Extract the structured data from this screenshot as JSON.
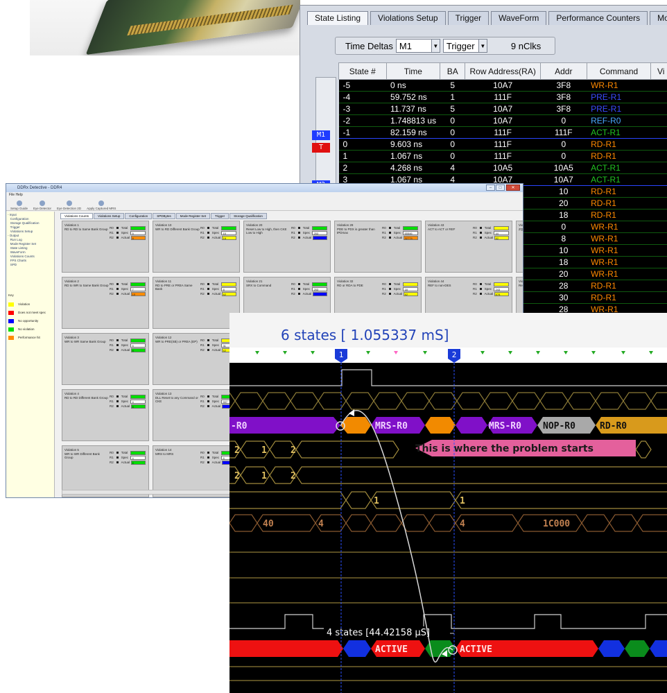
{
  "state_listing": {
    "tabs": [
      "State Listing",
      "Violations Setup",
      "Trigger",
      "WaveForm",
      "Performance Counters",
      "Mo"
    ],
    "time_deltas_label": "Time Deltas",
    "from_marker": "M1",
    "to_marker": "Trigger",
    "nclks": "9 nClks",
    "columns": [
      "State #",
      "Time",
      "BA",
      "Row Address(RA)",
      "Addr",
      "Command",
      "Vi"
    ],
    "markers": [
      {
        "label": "M1",
        "color": "#1f3cff"
      },
      {
        "label": "T",
        "color": "#e01010"
      },
      {
        "label": "M2",
        "color": "#1f3cff"
      }
    ],
    "rows": [
      {
        "state": "-5",
        "time": "0 ns",
        "ba": "5",
        "ra": "10A7",
        "addr": "3F8",
        "cmd": "WR-R1",
        "color": "#ff8a00"
      },
      {
        "state": "-4",
        "time": "59.752 ns",
        "ba": "1",
        "ra": "111F",
        "addr": "3F8",
        "cmd": "PRE-R1",
        "color": "#3a4dff"
      },
      {
        "state": "-3",
        "time": "11.737 ns",
        "ba": "5",
        "ra": "10A7",
        "addr": "3F8",
        "cmd": "PRE-R1",
        "color": "#3a4dff"
      },
      {
        "state": "-2",
        "time": "1.748813 us",
        "ba": "0",
        "ra": "10A7",
        "addr": "0",
        "cmd": "REF-R0",
        "color": "#4aa8ff"
      },
      {
        "state": "-1",
        "time": "82.159 ns",
        "ba": "0",
        "ra": "111F",
        "addr": "111F",
        "cmd": "ACT-R1",
        "color": "#21c421"
      },
      {
        "state": "0",
        "time": "9.603 ns",
        "ba": "0",
        "ra": "111F",
        "addr": "0",
        "cmd": "RD-R1",
        "color": "#ff8a00"
      },
      {
        "state": "1",
        "time": "1.067 ns",
        "ba": "0",
        "ra": "111F",
        "addr": "0",
        "cmd": "RD-R1",
        "color": "#ff8a00"
      },
      {
        "state": "2",
        "time": "4.268 ns",
        "ba": "4",
        "ra": "10A5",
        "addr": "10A5",
        "cmd": "ACT-R1",
        "color": "#21c421"
      },
      {
        "state": "3",
        "time": "1.067 ns",
        "ba": "4",
        "ra": "10A7",
        "addr": "10A7",
        "cmd": "ACT-R1",
        "color": "#21c421"
      },
      {
        "state": "",
        "time": "",
        "ba": "",
        "ra": "",
        "addr": "10",
        "cmd": "RD-R1",
        "color": "#ff8a00"
      },
      {
        "state": "",
        "time": "",
        "ba": "",
        "ra": "",
        "addr": "20",
        "cmd": "RD-R1",
        "color": "#ff8a00"
      },
      {
        "state": "",
        "time": "",
        "ba": "",
        "ra": "",
        "addr": "18",
        "cmd": "RD-R1",
        "color": "#ff8a00"
      },
      {
        "state": "",
        "time": "",
        "ba": "",
        "ra": "",
        "addr": "0",
        "cmd": "WR-R1",
        "color": "#ff8a00"
      },
      {
        "state": "",
        "time": "",
        "ba": "",
        "ra": "",
        "addr": "8",
        "cmd": "WR-R1",
        "color": "#ff8a00"
      },
      {
        "state": "",
        "time": "",
        "ba": "",
        "ra": "",
        "addr": "10",
        "cmd": "WR-R1",
        "color": "#ff8a00"
      },
      {
        "state": "",
        "time": "",
        "ba": "",
        "ra": "",
        "addr": "18",
        "cmd": "WR-R1",
        "color": "#ff8a00"
      },
      {
        "state": "",
        "time": "",
        "ba": "",
        "ra": "",
        "addr": "20",
        "cmd": "WR-R1",
        "color": "#ff8a00"
      },
      {
        "state": "",
        "time": "",
        "ba": "",
        "ra": "",
        "addr": "28",
        "cmd": "RD-R1",
        "color": "#ff8a00"
      },
      {
        "state": "",
        "time": "",
        "ba": "",
        "ra": "",
        "addr": "30",
        "cmd": "RD-R1",
        "color": "#ff8a00"
      },
      {
        "state": "",
        "time": "",
        "ba": "",
        "ra": "",
        "addr": "28",
        "cmd": "WR-R1",
        "color": "#ff8a00"
      }
    ]
  },
  "detective": {
    "title": "DDRx Detective - DDR4",
    "menu": "File   Help",
    "toolbar": [
      "Setup Guide",
      "Eye Detector",
      "Eye Detection 2D",
      "Apply Captured MRS"
    ],
    "tree": [
      "- Input",
      "   Configuration",
      "   Storage Qualification",
      "   Trigger",
      "   Violations Setup",
      "- Output",
      "   Run Log",
      "   Mode Register Set",
      "   State Listing",
      "   WaveForm",
      "   Violations Counts",
      "   FPS Charts",
      "   SPD"
    ],
    "key_title": "Key",
    "key": [
      {
        "label": "Violation",
        "color": "#ffff00"
      },
      {
        "label": "Does not meet spec",
        "color": "#ff0000"
      },
      {
        "label": "No opportunity",
        "color": "#0000ff"
      },
      {
        "label": "No violation",
        "color": "#00dd00"
      },
      {
        "label": "Performance hit",
        "color": "#ff8c00"
      }
    ],
    "tabs": [
      "Violations Counts",
      "Violations Setup",
      "Configuration",
      "SPDBytes",
      "Mode Register Set",
      "Trigger",
      "Storage Qualification"
    ],
    "violations": [
      {
        "name": "Violation 1",
        "desc": "RD to RD to Same Bank Group",
        "total_color": "#00dd00",
        "spec": "5",
        "actual": "6",
        "actual_color": "#ff8c00"
      },
      {
        "name": "Violation 10",
        "desc": "WR to RD Different Bank Group",
        "total_color": "#00dd00",
        "spec": "15",
        "actual": "16",
        "actual_color": "#ffff00"
      },
      {
        "name": "Violation 20",
        "desc": "Reset Low to High, then CKE Low to High",
        "total_color": "#00dd00",
        "spec": "253",
        "actual": "",
        "actual_color": "#0000ff"
      },
      {
        "name": "Violation 29",
        "desc": "PDE to PDX is greater than tPDmax",
        "total_color": "#00dd00",
        "spec": "65546",
        "actual": "32774",
        "actual_color": "#ff8c00"
      },
      {
        "name": "Violation 43",
        "desc": "ACT to ACT or REF",
        "total_color": "#ffff00",
        "spec": "44",
        "actual": "62",
        "actual_color": "#ffff00"
      },
      {
        "name": "Violation 52",
        "desc": "ZQCS or ZQ Active Bank",
        "total_color": "#00dd00",
        "spec": "",
        "actual": "",
        "actual_color": "#0000ff"
      },
      {
        "name": "Violation 2",
        "desc": "RD to WR to Same Bank Group",
        "total_color": "#00dd00",
        "spec": "7",
        "actual": "10",
        "actual_color": "#ff8c00"
      },
      {
        "name": "Violation 11",
        "desc": "RD to PRE or PREA Same Bank",
        "total_color": "#ffff00",
        "spec": "8",
        "actual": "62",
        "actual_color": "#ffff00"
      },
      {
        "name": "Violation 21",
        "desc": "SRX to Command",
        "total_color": "#00dd00",
        "spec": "253",
        "actual": "",
        "actual_color": "#0000ff"
      },
      {
        "name": "Violation 32",
        "desc": "RD or RDA to PDE",
        "total_color": "#ffff00",
        "spec": "18",
        "actual": "62",
        "actual_color": "#ffff00"
      },
      {
        "name": "Violation 44",
        "desc": "REF to non-DES",
        "total_color": "#ffff00",
        "spec": "243",
        "actual": "678",
        "actual_color": "#ffff00"
      },
      {
        "name": "Violation 53",
        "desc": "Read to Rea Rank)",
        "total_color": "#00dd00",
        "spec": "",
        "actual": "",
        "actual_color": "#0000ff"
      },
      {
        "name": "Violation 3",
        "desc": "WR to WR Same Bank Group",
        "total_color": "#00dd00",
        "spec": "5",
        "actual": "6",
        "actual_color": "#00dd00"
      },
      {
        "name": "Violation 12",
        "desc": "WR to PRE(SB) or PREA (EP)",
        "total_color": "#ffff00",
        "spec": "31",
        "actual": "62",
        "actual_color": "#ffff00"
      },
      {
        "name": "Violation 22",
        "desc": "SRX to Non-Deselect",
        "total_color": "#00dd00",
        "spec": "113",
        "actual": "",
        "actual_color": "#0000ff"
      },
      {
        "name": "Violation 33",
        "desc": "WR to PDE, >WRPDEN_po",
        "total_color": "#ffff00",
        "spec": "31",
        "actual": "62",
        "actual_color": "#ffff00"
      },
      {
        "name": "Violation 45",
        "desc": "REF to REF Average Interval",
        "total_color": "#00dd00",
        "spec": "7283",
        "actual": "5988",
        "actual_color": "#ff0000"
      },
      {
        "name": "Violation 55",
        "desc": "Read to Wri Rank)",
        "total_color": "#00dd00",
        "spec": "",
        "actual": "",
        "actual_color": "#0000ff"
      },
      {
        "name": "Violation 4",
        "desc": "RD to RD Different Bank Group",
        "total_color": "#00dd00",
        "spec": "4",
        "actual": "6",
        "actual_color": "#00dd00"
      },
      {
        "name": "Violation 13",
        "desc": "DLL Reset to any Command or CKE",
        "total_color": "#00dd00",
        "spec": "597",
        "actual": "",
        "actual_color": "#0000ff"
      },
      {
        "name": "",
        "desc": "",
        "total_color": "",
        "spec": "",
        "actual": "",
        "actual_color": ""
      },
      {
        "name": "",
        "desc": "",
        "total_color": "",
        "spec": "",
        "actual": "",
        "actual_color": ""
      },
      {
        "name": "",
        "desc": "",
        "total_color": "",
        "spec": "",
        "actual": "",
        "actual_color": ""
      },
      {
        "name": "",
        "desc": "",
        "total_color": "",
        "spec": "",
        "actual": "",
        "actual_color": ""
      },
      {
        "name": "Violation 5",
        "desc": "WR to WR Different Bank Group",
        "total_color": "#00dd00",
        "spec": "4",
        "actual": "6",
        "actual_color": "#00dd00"
      },
      {
        "name": "Violation 14",
        "desc": "MRS to MRS",
        "total_color": "#00dd00",
        "spec": "8",
        "actual": "",
        "actual_color": "#0000ff"
      },
      {
        "name": "",
        "desc": "",
        "total_color": "",
        "spec": "",
        "actual": "",
        "actual_color": ""
      },
      {
        "name": "",
        "desc": "",
        "total_color": "",
        "spec": "",
        "actual": "",
        "actual_color": ""
      },
      {
        "name": "",
        "desc": "",
        "total_color": "",
        "spec": "",
        "actual": "",
        "actual_color": ""
      },
      {
        "name": "",
        "desc": "",
        "total_color": "",
        "spec": "",
        "actual": "",
        "actual_color": ""
      },
      {
        "name": "Violation 6",
        "desc": "Min ACT to ACT Same Bank Group",
        "total_color": "#00dd00",
        "spec": "5",
        "actual": "6",
        "actual_color": "#00dd00"
      },
      {
        "name": "Violation 15",
        "desc": "MRS to Other Command or ODT High",
        "total_color": "#00dd00",
        "spec": "24",
        "actual": "",
        "actual_color": "#0000ff"
      },
      {
        "name": "",
        "desc": "",
        "total_color": "",
        "spec": "",
        "actual": "",
        "actual_color": ""
      },
      {
        "name": "",
        "desc": "",
        "total_color": "",
        "spec": "",
        "actual": "",
        "actual_color": ""
      },
      {
        "name": "",
        "desc": "",
        "total_color": "",
        "spec": "",
        "actual": "",
        "actual_color": ""
      },
      {
        "name": "",
        "desc": "",
        "total_color": "",
        "spec": "",
        "actual": "",
        "actual_color": ""
      },
      {
        "name": "Violation 7",
        "desc": "Min ACT to ACT Different Bank Group",
        "total_color": "#00dd00",
        "spec": "4",
        "actual": "6",
        "actual_color": "#00dd00"
      },
      {
        "name": "Violation 17",
        "desc": "1st ZQCL after Reset Low to High",
        "total_color": "#00dd00",
        "spec": "1024",
        "actual": "",
        "actual_color": "#0000ff"
      },
      {
        "name": "",
        "desc": "",
        "total_color": "",
        "spec": "",
        "actual": "",
        "actual_color": ""
      },
      {
        "name": "",
        "desc": "",
        "total_color": "",
        "spec": "",
        "actual": "",
        "actual_color": ""
      },
      {
        "name": "",
        "desc": "",
        "total_color": "",
        "spec": "",
        "actual": "",
        "actual_color": ""
      },
      {
        "name": "",
        "desc": "",
        "total_color": "",
        "spec": "",
        "actual": "",
        "actual_color": ""
      },
      {
        "name": "Violation 8",
        "desc": "5 ACT < tFAWmin Same Rank",
        "total_color": "#00dd00",
        "spec": "22",
        "actual": "22",
        "actual_color": "#00dd00"
      },
      {
        "name": "Violation 18",
        "desc": "All but 1st ZQCL after Reset Low to High",
        "total_color": "#00dd00",
        "spec": "512",
        "actual": "",
        "actual_color": "#0000ff"
      },
      {
        "name": "",
        "desc": "",
        "total_color": "",
        "spec": "",
        "actual": "",
        "actual_color": ""
      },
      {
        "name": "",
        "desc": "",
        "total_color": "",
        "spec": "",
        "actual": "",
        "actual_color": ""
      },
      {
        "name": "",
        "desc": "",
        "total_color": "",
        "spec": "",
        "actual": "",
        "actual_color": ""
      },
      {
        "name": "",
        "desc": "",
        "total_color": "",
        "spec": "",
        "actual": "",
        "actual_color": ""
      },
      {
        "name": "Violation 9",
        "desc": "WR to RD Same Bank Group",
        "total_color": "#00dd00",
        "spec": "24",
        "actual": "",
        "actual_color": "#ff0000"
      },
      {
        "name": "Violation 19",
        "desc": "Time from ZQCS to any Command",
        "total_color": "#ffff00",
        "spec": "128",
        "actual": "213",
        "actual_color": "#ffff00"
      }
    ]
  },
  "waveform": {
    "states_label": "6 states [ 1.055337 mS]",
    "marker1": "1",
    "marker2": "2",
    "cmd_labels": [
      "-R0",
      "MRS-R0",
      "MRS-R0",
      "NOP-R0",
      "RD-R0"
    ],
    "callout": "This is where the problem starts",
    "bus_labels": {
      "row1": [
        "2",
        "1",
        "2"
      ],
      "row2": [
        "2",
        "1",
        "2"
      ],
      "row3": [
        "1",
        "1"
      ],
      "row4": [
        "40",
        "4",
        "4",
        "1C000"
      ]
    },
    "delta_label": "4 states  [44.42158 µS]",
    "active_labels": [
      "ACTIVE",
      "ACTIVE"
    ]
  }
}
